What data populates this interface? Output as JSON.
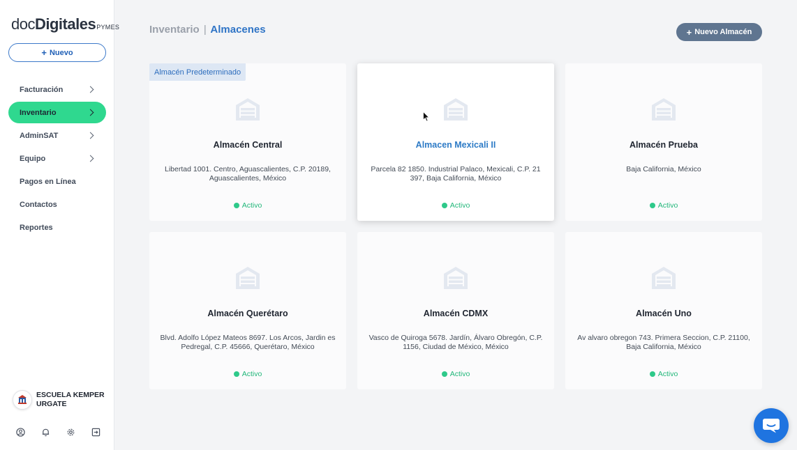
{
  "brand": {
    "doc": "doc",
    "digitales": "Digitales",
    "pymes": "PYMES"
  },
  "sidebar": {
    "new_button": {
      "icon": "plus-icon",
      "label": "Nuevo"
    },
    "items": [
      {
        "label": "Facturación",
        "has_chevron": true,
        "active": false
      },
      {
        "label": "Inventario",
        "has_chevron": true,
        "active": true
      },
      {
        "label": "AdminSAT",
        "has_chevron": true,
        "active": false
      },
      {
        "label": "Equipo",
        "has_chevron": true,
        "active": false
      },
      {
        "label": "Pagos en Línea",
        "has_chevron": false,
        "active": false
      },
      {
        "label": "Contactos",
        "has_chevron": false,
        "active": false
      },
      {
        "label": "Reportes",
        "has_chevron": false,
        "active": false
      }
    ],
    "company": {
      "line1": "ESCUELA KEMPER",
      "line2": "URGATE"
    },
    "bottom_icons": [
      "user-circle-icon",
      "bell-icon",
      "gear-icon",
      "logout-icon"
    ]
  },
  "header": {
    "parent": "Inventario",
    "separator": "|",
    "current": "Almacenes",
    "new_button": {
      "icon": "plus-icon",
      "label": "Nuevo Almacén"
    }
  },
  "cards": [
    {
      "badge": "Almacén Predeterminado",
      "name": "Almacén Central",
      "address": "Libertad 1001. Centro, Aguascalientes, C.P. 20189, Aguascalientes, México",
      "status": "Activo",
      "hover": false
    },
    {
      "badge": "",
      "name": "Almacen Mexicali II",
      "address": "Parcela 82 1850. Industrial Palaco, Mexicali, C.P. 21 397, Baja California, México",
      "status": "Activo",
      "hover": true
    },
    {
      "badge": "",
      "name": "Almacén Prueba",
      "address": "Baja California, México",
      "status": "Activo",
      "hover": false
    },
    {
      "badge": "",
      "name": "Almacén Querétaro",
      "address": "Blvd. Adolfo López Mateos 8697. Los Arcos, Jardin es Pedregal, C.P. 45666, Querétaro, México",
      "status": "Activo",
      "hover": false
    },
    {
      "badge": "",
      "name": "Almacén CDMX",
      "address": "Vasco de Quiroga 5678. Jardín, Álvaro Obregón, C.P. 1156, Ciudad de México, México",
      "status": "Activo",
      "hover": false
    },
    {
      "badge": "",
      "name": "Almacén Uno",
      "address": "Av alvaro obregon 743. Primera Seccion, C.P. 21100, Baja California, México",
      "status": "Activo",
      "hover": false
    }
  ],
  "colors": {
    "accent_green": "#2fd88f",
    "brand_blue": "#2f74c6",
    "button_slate": "#5f7590",
    "status_green": "#22b77a",
    "chat_blue": "#1f74e0"
  }
}
